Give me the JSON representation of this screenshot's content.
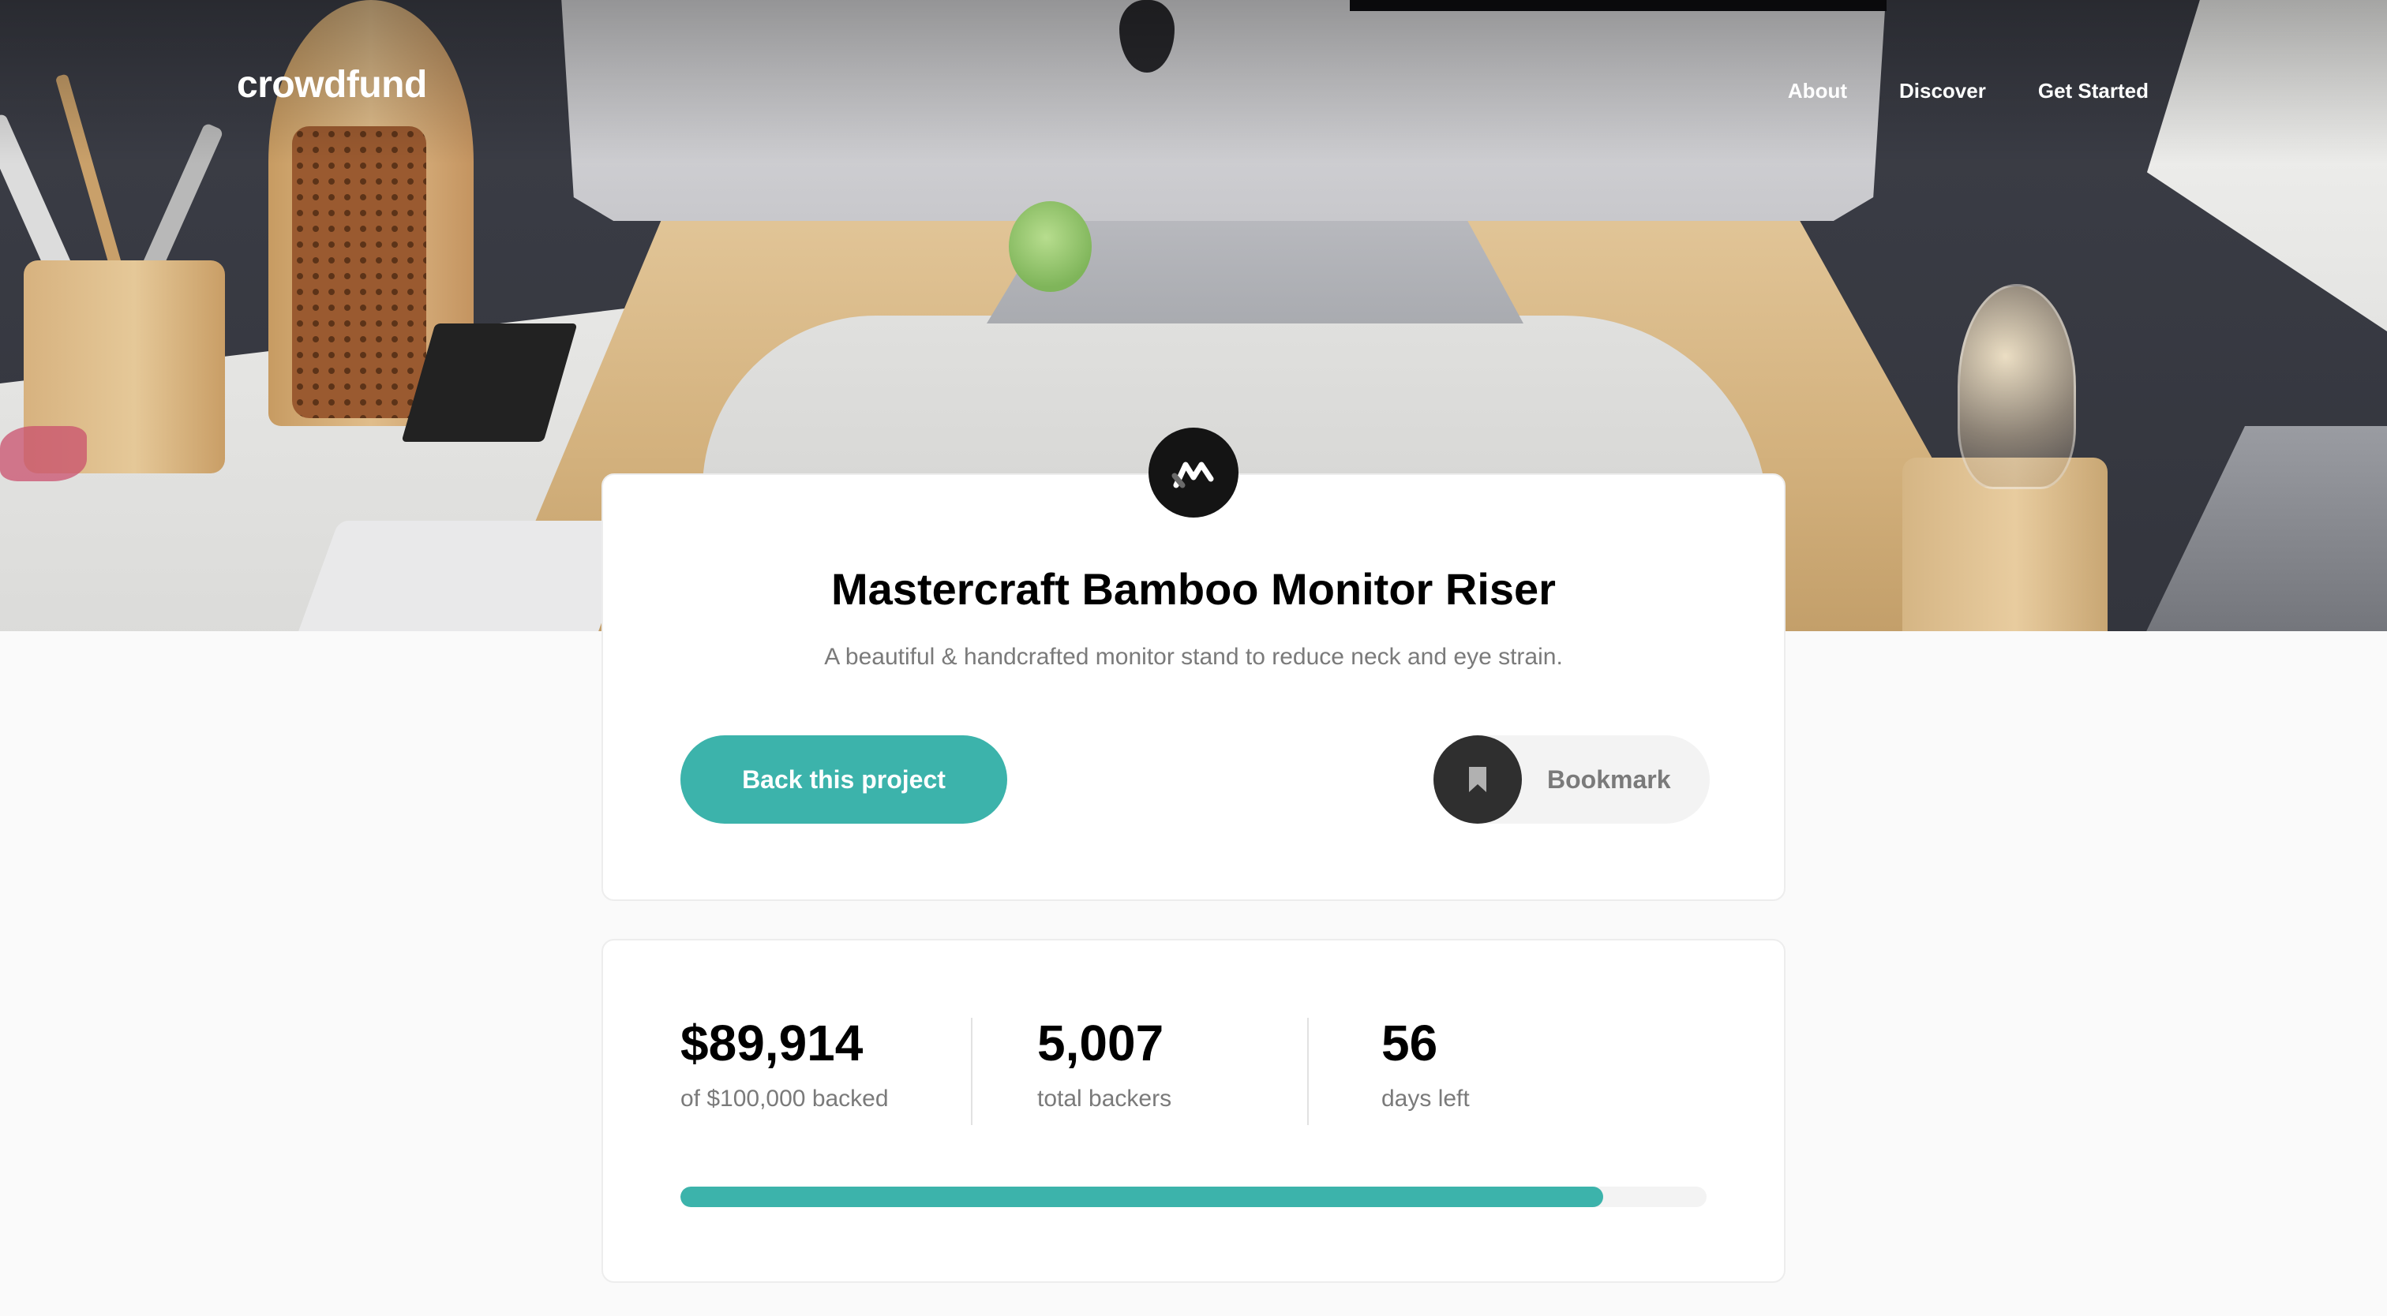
{
  "brand": {
    "logo": "crowdfund"
  },
  "nav": {
    "items": [
      {
        "label": "About"
      },
      {
        "label": "Discover"
      },
      {
        "label": "Get Started"
      }
    ]
  },
  "project": {
    "title": "Mastercraft Bamboo Monitor Riser",
    "description": "A beautiful & handcrafted monitor stand to reduce neck and eye strain.",
    "logo_icon": "mastercraft-logo-icon",
    "back_button": "Back this project",
    "bookmark_button": "Bookmark",
    "bookmark_icon": "bookmark-icon"
  },
  "stats": {
    "backed_amount": "$89,914",
    "backed_label": "of $100,000 backed",
    "total_backers": "5,007",
    "backers_label": "total backers",
    "days_left": "56",
    "days_label": "days left",
    "progress_percent": 89.914
  },
  "colors": {
    "accent": "#3cb3ab",
    "dark": "#2f2f2f",
    "muted": "#7a7a7a"
  }
}
